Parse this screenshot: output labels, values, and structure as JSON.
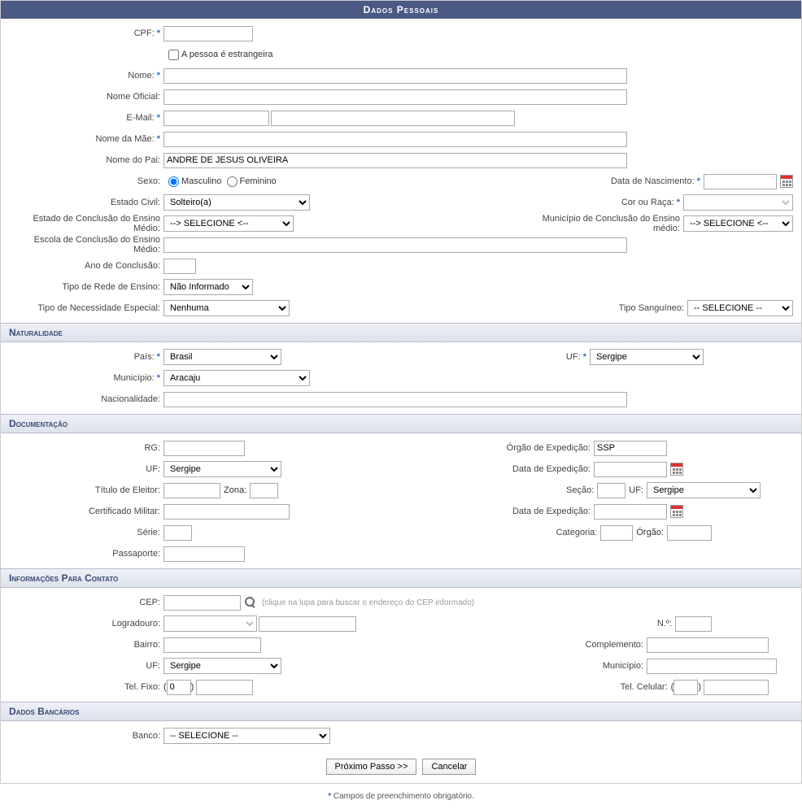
{
  "header": "Dados Pessoais",
  "labels": {
    "cpf": "CPF:",
    "estrangeira": "A pessoa é estrangeira",
    "nome": "Nome:",
    "nomeOficial": "Nome Oficial:",
    "email": "E-Mail:",
    "nomeMae": "Nome da Mãe:",
    "nomePai": "Nome do Pai:",
    "sexo": "Sexo:",
    "masculino": "Masculino",
    "feminino": "Feminino",
    "dataNasc": "Data de Nascimento:",
    "estadoCivil": "Estado Civil:",
    "corRaca": "Cor ou Raça:",
    "estadoConclusao": "Estado de Conclusão do Ensino Médio:",
    "municipioConclusao": "Município de Conclusão do Ensino médio:",
    "escolaConclusao": "Escola de Conclusão do Ensino Médio:",
    "anoConclusao": "Ano de Conclusão:",
    "tipoRede": "Tipo de Rede de Ensino:",
    "tipoNecessidade": "Tipo de Necessidade Especial:",
    "tipoSanguineo": "Tipo Sanguíneo:",
    "pais": "País:",
    "uf": "UF:",
    "municipio": "Município:",
    "nacionalidade": "Nacionalidade:",
    "rg": "RG:",
    "orgaoExp": "Órgão de Expedição:",
    "dataExp": "Data de Expedição:",
    "tituloEleitor": "Título de Eleitor:",
    "zona": "Zona:",
    "secao": "Seção:",
    "certMilitar": "Certificado Militar:",
    "serie": "Série:",
    "categoria": "Categoria:",
    "orgao": "Órgão:",
    "passaporte": "Passaporte:",
    "cep": "CEP:",
    "cepHint": "(clique na lupa para buscar o endereço do CEP informado)",
    "logradouro": "Logradouro:",
    "numero": "N.º:",
    "bairro": "Bairro:",
    "complemento": "Complemento:",
    "telFixo": "Tel. Fixo:",
    "telCelular": "Tel. Celular:",
    "banco": "Banco:"
  },
  "sections": {
    "naturalidade": "Naturalidade",
    "documentacao": "Documentação",
    "contato": "Informações Para Contato",
    "bancarios": "Dados Bancários"
  },
  "values": {
    "cpf": "",
    "nome": "",
    "nomeOficial": "",
    "email": "",
    "nomeMae": "",
    "nomePai": "ANDRE DE JESUS OLIVEIRA",
    "dataNasc": "",
    "estadoCivil": "Solteiro(a)",
    "corRaca": "",
    "estadoConclusao": "--> SELECIONE <--",
    "municipioConclusao": "--> SELECIONE <--",
    "escolaConclusao": "",
    "anoConclusao": "",
    "tipoRede": "Não Informado",
    "tipoNecessidade": "Nenhuma",
    "tipoSanguineo": "-- SELECIONE --",
    "pais": "Brasil",
    "ufNat": "Sergipe",
    "municipioNat": "Aracaju",
    "nacionalidade": "",
    "rg": "",
    "orgaoExp": "SSP",
    "ufRg": "Sergipe",
    "dataExpRg": "",
    "tituloEleitor": "",
    "zona": "",
    "secao": "",
    "ufTitulo": "Sergipe",
    "certMilitar": "",
    "dataExpMilitar": "",
    "serie": "",
    "categoria": "",
    "orgaoMilitar": "",
    "passaporte": "",
    "cep": "",
    "logradouroTipo": "",
    "logradouro": "",
    "numero": "",
    "bairro": "",
    "complemento": "",
    "ufContato": "Sergipe",
    "municipioContato": "",
    "telFixoDDD": "0",
    "telFixo": "",
    "telCelDDD": "",
    "telCel": "",
    "banco": "-- SELECIONE --"
  },
  "buttons": {
    "proximo": "Próximo Passo >>",
    "cancelar": "Cancelar"
  },
  "footer": "Campos de preenchimento obrigatório."
}
